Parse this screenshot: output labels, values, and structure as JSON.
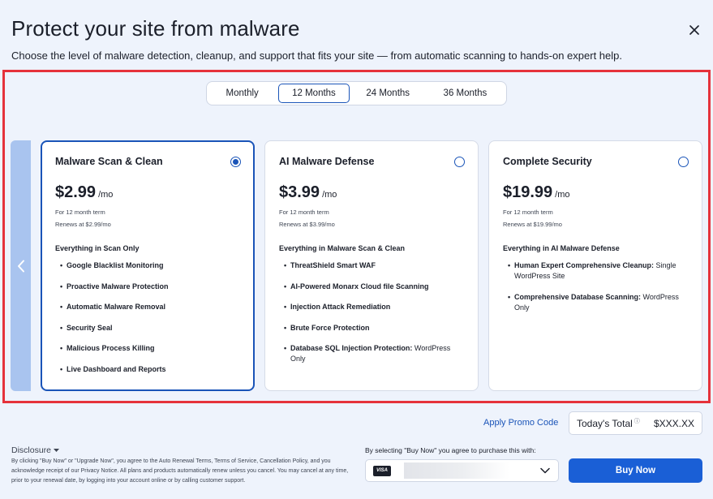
{
  "header": {
    "title": "Protect your site from malware",
    "subtitle": "Choose the level of malware detection, cleanup, and support that fits your site — from automatic scanning to hands-on expert help."
  },
  "terms": [
    {
      "label": "Monthly",
      "active": false
    },
    {
      "label": "12 Months",
      "active": true
    },
    {
      "label": "24 Months",
      "active": false
    },
    {
      "label": "36 Months",
      "active": false
    }
  ],
  "plans": [
    {
      "name": "Malware Scan & Clean",
      "selected": true,
      "price": "$2.99",
      "per": "/mo",
      "term_note": "For 12 month term",
      "renew_note": "Renews at $2.99/mo",
      "includes": "Everything in Scan Only",
      "features": [
        {
          "bold": "Google Blacklist Monitoring",
          "rest": ""
        },
        {
          "bold": "Proactive Malware Protection",
          "rest": ""
        },
        {
          "bold": "Automatic Malware Removal",
          "rest": ""
        },
        {
          "bold": "Security Seal",
          "rest": ""
        },
        {
          "bold": "Malicious Process Killing",
          "rest": ""
        },
        {
          "bold": "Live Dashboard and Reports",
          "rest": ""
        }
      ]
    },
    {
      "name": "AI Malware Defense",
      "selected": false,
      "price": "$3.99",
      "per": "/mo",
      "term_note": "For 12 month term",
      "renew_note": "Renews at $3.99/mo",
      "includes": "Everything in Malware Scan & Clean",
      "features": [
        {
          "bold": "ThreatShield Smart WAF",
          "rest": ""
        },
        {
          "bold": "AI-Powered Monarx Cloud file Scanning",
          "rest": ""
        },
        {
          "bold": "Injection Attack Remediation",
          "rest": ""
        },
        {
          "bold": "Brute Force Protection",
          "rest": ""
        },
        {
          "bold": "Database SQL Injection Protection:",
          "rest": " WordPress Only"
        }
      ]
    },
    {
      "name": "Complete Security",
      "selected": false,
      "price": "$19.99",
      "per": "/mo",
      "term_note": "For 12 month term",
      "renew_note": "Renews at $19.99/mo",
      "includes": "Everything in AI Malware Defense",
      "features": [
        {
          "bold": "Human Expert Comprehensive Cleanup:",
          "rest": " Single WordPress Site"
        },
        {
          "bold": "Comprehensive Database Scanning:",
          "rest": " WordPress Only"
        }
      ]
    }
  ],
  "checkout": {
    "promo_link": "Apply Promo Code",
    "total_label": "Today's Total",
    "total_value": "$XXX.XX",
    "disclosure_title": "Disclosure",
    "disclosure_text": "By clicking \"Buy Now\" or \"Upgrade Now\", you agree to the Auto Renewal Terms, Terms of Service, Cancellation Policy, and you acknowledge receipt of our Privacy Notice. All plans and products automatically renew unless you cancel. You may cancel at any time, prior to your renewal date, by logging into your account online or by calling customer support.",
    "purchase_note": "By selecting \"Buy Now\" you agree to purchase this with:",
    "card_brand": "VISA",
    "buy_label": "Buy Now"
  },
  "colors": {
    "accent": "#1a54b8",
    "buy_button": "#1a5fd6",
    "highlight_border": "#e5323b",
    "background": "#eef3fc"
  },
  "icons": {
    "close": "close-icon",
    "prev": "chevron-left-icon",
    "dropdown": "chevron-down-icon",
    "disclosure": "caret-down-icon",
    "info": "info-icon"
  }
}
